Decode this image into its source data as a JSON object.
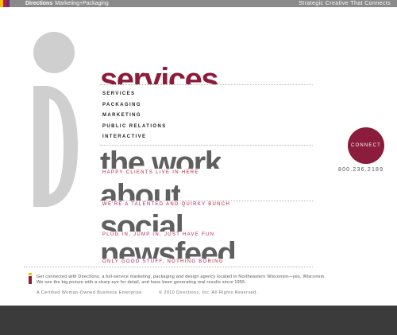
{
  "header": {
    "brand": "Directions",
    "brand_suffix": "Marketing+Packaging",
    "tagline": "Strategic Creative That Connects",
    "stripe_colors": [
      "#f0c300",
      "#b41f45",
      "#6f2b6b"
    ]
  },
  "sections": {
    "services": "services",
    "work": "the work",
    "about": "about",
    "social": "social",
    "newsfeed": "newsfeed"
  },
  "menu": [
    "SERVICES",
    "PACKAGING",
    "MARKETING",
    "PUBLIC RELATIONS",
    "INTERACTIVE"
  ],
  "taglines": {
    "work": "HAPPY CLIENTS LIVE IN HERE",
    "about": "WE'RE A TALENTED AND QUIRKY BUNCH",
    "social": "PLUG IN, JUMP IN, JUST HAVE FUN",
    "newsfeed": "ONLY GOOD STUFF, NOTHING BORING"
  },
  "connect": {
    "label": "CONNECT",
    "phone": "800.236.2189"
  },
  "footer": {
    "line1": "Get connected with Directions, a full-service marketing, packaging and design agency located in Northeastern Wisconsin—yes, Wisconsin.",
    "line2": "We see the big picture with a sharp eye for detail, and have been generating real results since 1955.",
    "certified": "A Certified Woman-Owned Business Enterprise",
    "copyright": "© 2010 Directions, Inc. All Rights Reserved."
  },
  "colors": {
    "accent": "#8b1c3b",
    "accent_text": "#b41f45",
    "logo_gray": "#cfcfcf",
    "heading_gray": "#5f5f5f",
    "bottom_bar": "#3b3b3b"
  },
  "icons": {
    "logo": "directions-i-logo",
    "small_logo": "small-i-logo"
  }
}
